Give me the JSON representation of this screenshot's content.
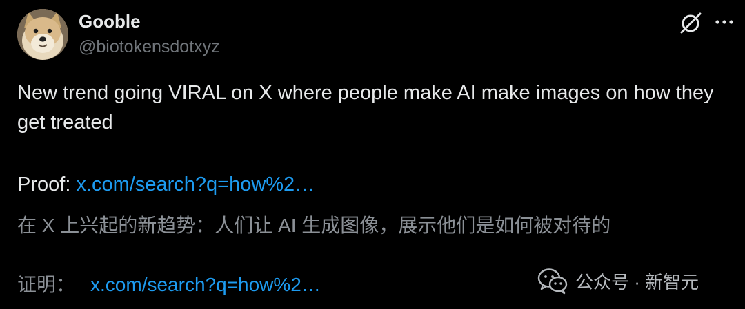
{
  "author": {
    "display_name": "Gooble",
    "handle": "@biotokensdotxyz",
    "avatar_icon": "shiba-dog-avatar"
  },
  "actions": {
    "grok_icon": "grok-slash-circle-icon",
    "more_icon": "more-dots-icon"
  },
  "tweet": {
    "text": "New trend going VIRAL on X where people make AI make images on how they get treated",
    "proof_label": "Proof: ",
    "proof_link": "x.com/search?q=how%2…"
  },
  "translation": {
    "text": "在 X 上兴起的新趋势：人们让 AI 生成图像，展示他们是如何被对待的",
    "proof_label": "证明：",
    "proof_link": "x.com/search?q=how%2…"
  },
  "watermark": {
    "text": "公众号 · 新智元",
    "icon": "wechat-icon"
  },
  "colors": {
    "background": "#000000",
    "primary_text": "#e7e9ea",
    "secondary_text": "#71767b",
    "link": "#1d9bf0"
  }
}
